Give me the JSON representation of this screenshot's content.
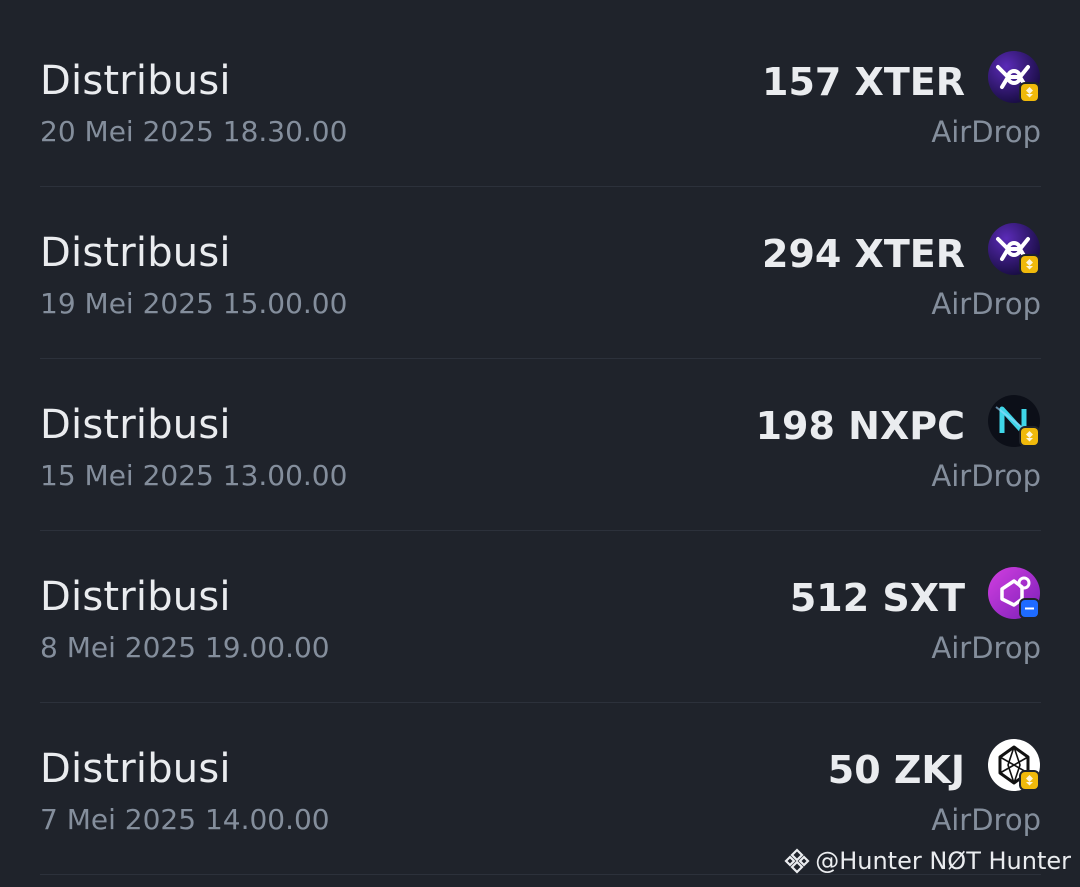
{
  "transactions": [
    {
      "type": "Distribusi",
      "date": "20 Mei 2025 18.30.00",
      "amount": "157 XTER",
      "source": "AirDrop",
      "coin_icon": "xter-icon",
      "badge": "bnb-badge"
    },
    {
      "type": "Distribusi",
      "date": "19 Mei 2025 15.00.00",
      "amount": "294 XTER",
      "source": "AirDrop",
      "coin_icon": "xter-icon",
      "badge": "bnb-badge"
    },
    {
      "type": "Distribusi",
      "date": "15 Mei 2025 13.00.00",
      "amount": "198 NXPC",
      "source": "AirDrop",
      "coin_icon": "nxpc-icon",
      "badge": "bnb-badge"
    },
    {
      "type": "Distribusi",
      "date": "8 Mei 2025 19.00.00",
      "amount": "512 SXT",
      "source": "AirDrop",
      "coin_icon": "sxt-icon",
      "badge": "eth-badge"
    },
    {
      "type": "Distribusi",
      "date": "7 Mei 2025 14.00.00",
      "amount": "50 ZKJ",
      "source": "AirDrop",
      "coin_icon": "zkj-icon",
      "badge": "bnb-badge"
    }
  ],
  "watermark": {
    "text": "@Hunter NØT Hunter",
    "icon": "binance-logo-icon"
  },
  "colors": {
    "background": "#1f232b",
    "primary_text": "#eaecef",
    "secondary_text": "#848e9c",
    "divider": "#2c313b",
    "bnb_badge": "#f0b90b",
    "eth_badge": "#1e6bff"
  }
}
